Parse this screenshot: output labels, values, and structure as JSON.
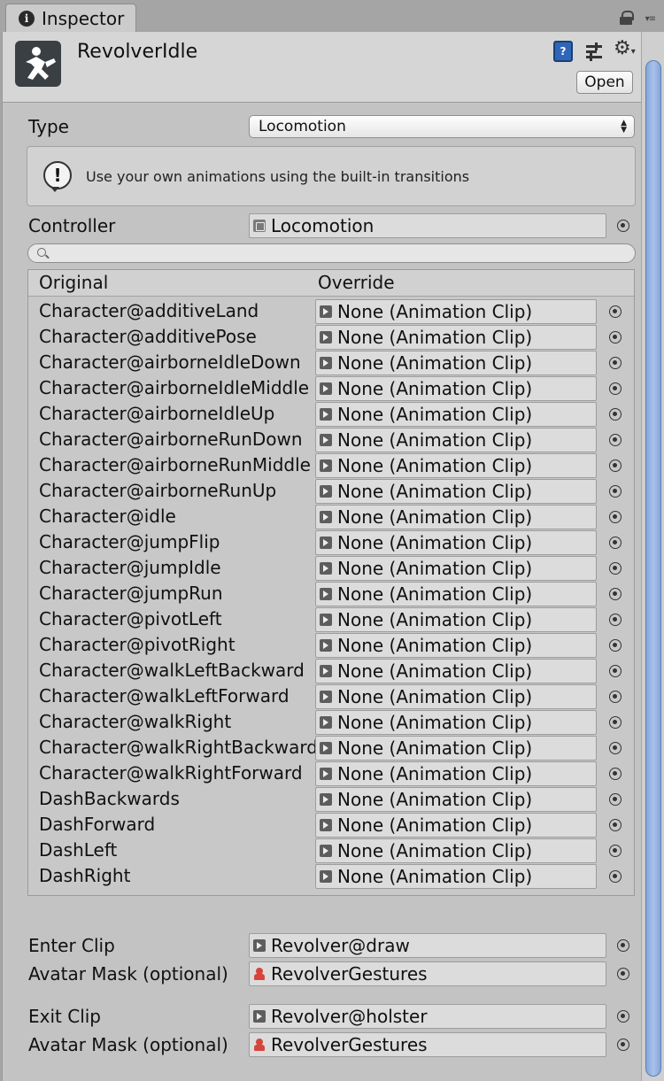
{
  "window": {
    "tab_label": "Inspector",
    "tab_icon_glyph": "i",
    "tab_menu_glyph": "▾≡"
  },
  "header": {
    "title": "RevolverIdle",
    "book_glyph": "?",
    "gear_glyph": "⚙",
    "gear_menu_glyph": "▾",
    "open_button": "Open"
  },
  "type": {
    "label": "Type",
    "value": "Locomotion"
  },
  "help": {
    "icon_glyph": "!",
    "text": "Use your own animations using the built-in transitions"
  },
  "controller": {
    "label": "Controller",
    "value": "Locomotion"
  },
  "search": {
    "placeholder": ""
  },
  "table": {
    "col_original": "Original",
    "col_override": "Override",
    "rows": [
      {
        "original": "Character@additiveLand",
        "override": "None (Animation Clip)"
      },
      {
        "original": "Character@additivePose",
        "override": "None (Animation Clip)"
      },
      {
        "original": "Character@airborneIdleDown",
        "override": "None (Animation Clip)"
      },
      {
        "original": "Character@airborneIdleMiddle",
        "override": "None (Animation Clip)"
      },
      {
        "original": "Character@airborneIdleUp",
        "override": "None (Animation Clip)"
      },
      {
        "original": "Character@airborneRunDown",
        "override": "None (Animation Clip)"
      },
      {
        "original": "Character@airborneRunMiddle",
        "override": "None (Animation Clip)"
      },
      {
        "original": "Character@airborneRunUp",
        "override": "None (Animation Clip)"
      },
      {
        "original": "Character@idle",
        "override": "None (Animation Clip)"
      },
      {
        "original": "Character@jumpFlip",
        "override": "None (Animation Clip)"
      },
      {
        "original": "Character@jumpIdle",
        "override": "None (Animation Clip)"
      },
      {
        "original": "Character@jumpRun",
        "override": "None (Animation Clip)"
      },
      {
        "original": "Character@pivotLeft",
        "override": "None (Animation Clip)"
      },
      {
        "original": "Character@pivotRight",
        "override": "None (Animation Clip)"
      },
      {
        "original": "Character@walkLeftBackward",
        "override": "None (Animation Clip)"
      },
      {
        "original": "Character@walkLeftForward",
        "override": "None (Animation Clip)"
      },
      {
        "original": "Character@walkRight",
        "override": "None (Animation Clip)"
      },
      {
        "original": "Character@walkRightBackward",
        "override": "None (Animation Clip)"
      },
      {
        "original": "Character@walkRightForward",
        "override": "None (Animation Clip)"
      },
      {
        "original": "DashBackwards",
        "override": "None (Animation Clip)"
      },
      {
        "original": "DashForward",
        "override": "None (Animation Clip)"
      },
      {
        "original": "DashLeft",
        "override": "None (Animation Clip)"
      },
      {
        "original": "DashRight",
        "override": "None (Animation Clip)"
      }
    ]
  },
  "enter": {
    "clip_label": "Enter Clip",
    "clip_value": "Revolver@draw",
    "mask_label": "Avatar Mask (optional)",
    "mask_value": "RevolverGestures"
  },
  "exit": {
    "clip_label": "Exit Clip",
    "clip_value": "Revolver@holster",
    "mask_label": "Avatar Mask (optional)",
    "mask_value": "RevolverGestures"
  },
  "colors": {
    "panel": "#c3c3c3",
    "header": "#d6d6d6",
    "scroll_thumb": "#a9c3ec",
    "mask_icon": "#d4453e"
  }
}
